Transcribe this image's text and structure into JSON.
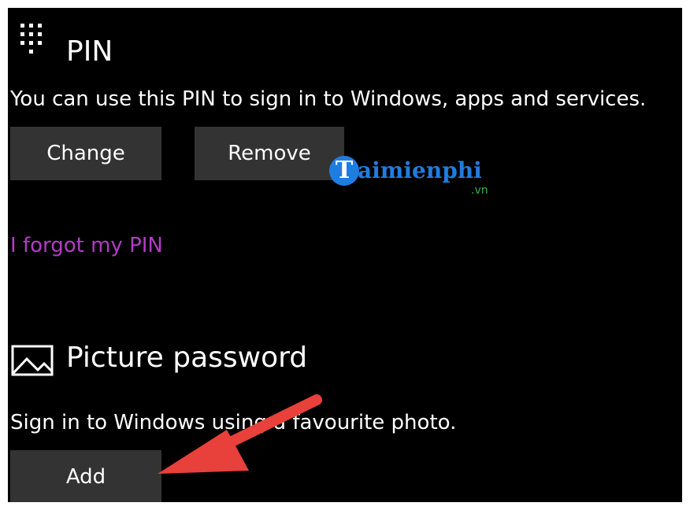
{
  "pin_section": {
    "title": "PIN",
    "description": "You can use this PIN to sign in to Windows, apps and services.",
    "change_label": "Change",
    "remove_label": "Remove",
    "forgot_link": "I forgot my PIN",
    "icon": "keypad-icon"
  },
  "picture_password_section": {
    "title": "Picture password",
    "description": "Sign in to Windows using a favourite photo.",
    "add_label": "Add",
    "icon": "picture-icon"
  },
  "watermark": {
    "initial": "T",
    "brand": "aimienphi",
    "suffix": ".vn"
  },
  "colors": {
    "background": "#000000",
    "button": "#333333",
    "link": "#b23cc6",
    "annotation_arrow": "#e8403a",
    "watermark_blue": "#1f7de0",
    "watermark_green": "#30b04a"
  }
}
